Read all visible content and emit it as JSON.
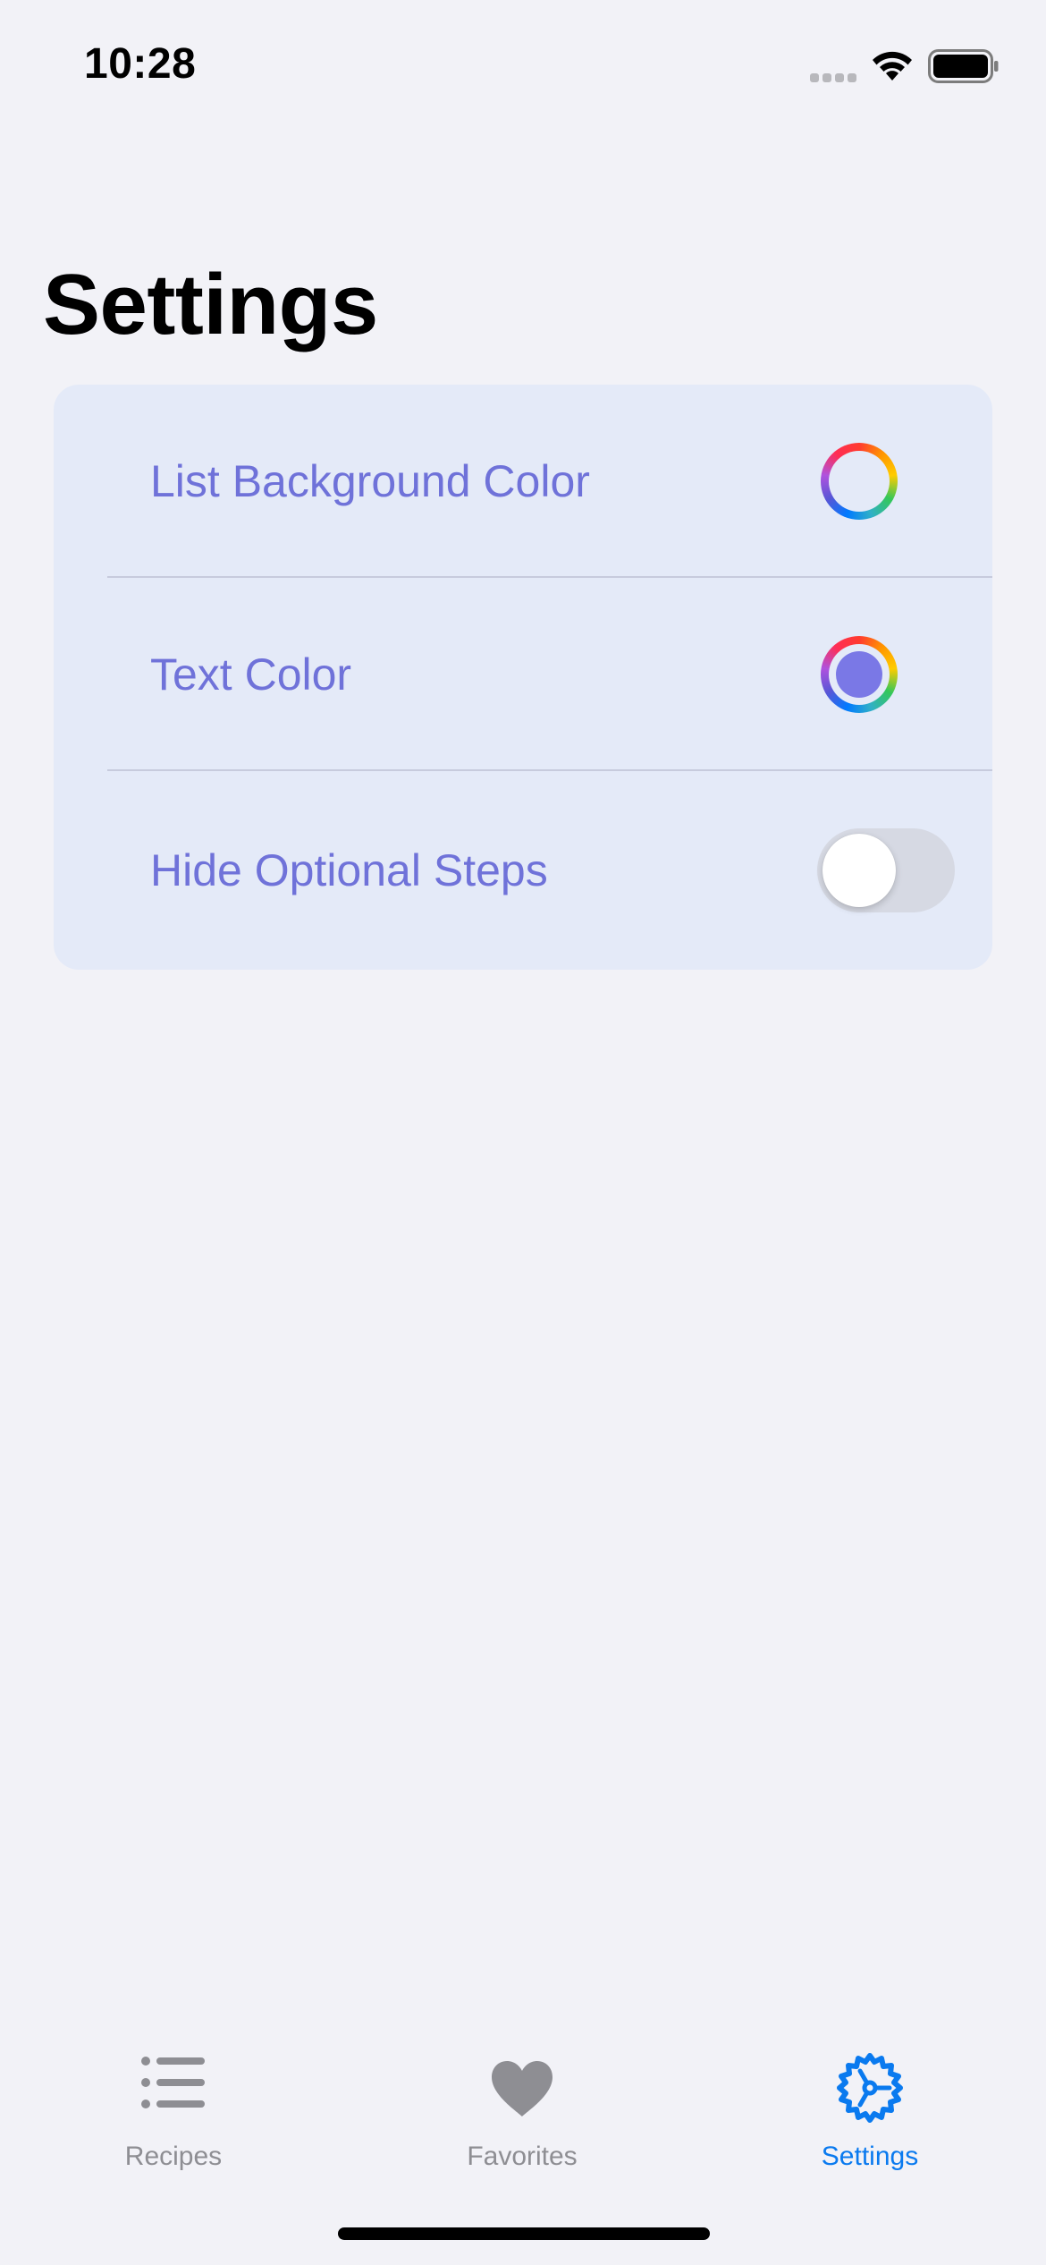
{
  "status_bar": {
    "time": "10:28"
  },
  "page": {
    "title": "Settings"
  },
  "settings": {
    "rows": [
      {
        "label": "List Background Color",
        "control": "color-well",
        "value_color": "#e4eaf8"
      },
      {
        "label": "Text Color",
        "control": "color-well",
        "value_color": "#7a78e6"
      },
      {
        "label": "Hide Optional Steps",
        "control": "toggle",
        "value": false
      }
    ]
  },
  "tab_bar": {
    "items": [
      {
        "label": "Recipes",
        "icon": "list-bullet-icon",
        "selected": false
      },
      {
        "label": "Favorites",
        "icon": "heart-icon",
        "selected": false
      },
      {
        "label": "Settings",
        "icon": "gear-icon",
        "selected": true
      }
    ]
  },
  "colors": {
    "background": "#f2f2f7",
    "card": "#e4eaf8",
    "label_text": "#6f72d9",
    "accent": "#0a7aef",
    "inactive_tab": "#8e8e93"
  }
}
